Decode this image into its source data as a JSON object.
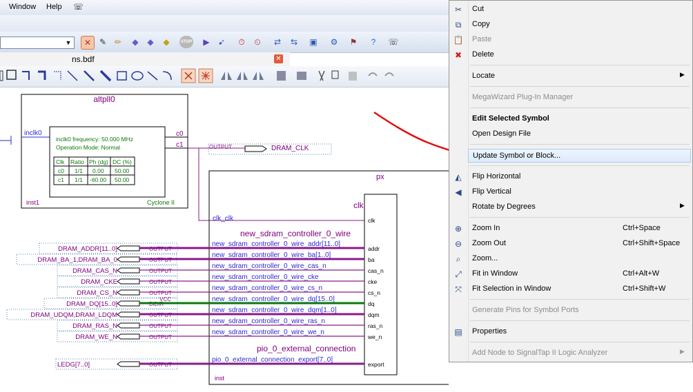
{
  "menubar": {
    "window_label": "Window",
    "help_label": "Help"
  },
  "doc_tab": {
    "title": "ns.bdf",
    "close_glyph": "✕"
  },
  "toolbar1": {
    "stop_label": "STOP"
  },
  "schematic": {
    "altpll": {
      "name": "altpll0",
      "pin_in": "inclk0",
      "pin_c0": "c0",
      "pin_c1": "c1",
      "info_freq": "inclk0 frequency: 50.000 MHz",
      "info_mode": "Operation Mode: Normal",
      "table_header": [
        "Clk",
        "Ratio",
        "Ph (dg)",
        "DC (%)"
      ],
      "table_rows": [
        [
          "c0",
          "1/1",
          "0.00",
          "50.00"
        ],
        [
          "c1",
          "1/1",
          "-60.00",
          "50.00"
        ]
      ],
      "inst": "inst1",
      "device": "Cyclone II"
    },
    "output_pin_label": "OUTPUT",
    "dram_clk": "DRAM_CLK",
    "px": {
      "name": "px",
      "clk_title": "clk",
      "clk_port": "clk",
      "clk_net": "clk_clk",
      "sdram_title": "new_sdram_controller_0_wire",
      "pio_title": "pio_0_external_connection",
      "inst": "inst",
      "corner": "px",
      "ports": [
        "addr",
        "ba",
        "cas_n",
        "cke",
        "cs_n",
        "dq",
        "dqm",
        "ras_n",
        "we_n"
      ],
      "export_port": "export",
      "wires": [
        "new_sdram_controller_0_wire_addr[11..0]",
        "new_sdram_controller_0_wire_ba[1..0]",
        "new_sdram_controller_0_wire_cas_n",
        "new_sdram_controller_0_wire_cke",
        "new_sdram_controller_0_wire_cs_n",
        "new_sdram_controller_0_wire_dq[15..0]",
        "new_sdram_controller_0_wire_dqm[1..0]",
        "new_sdram_controller_0_wire_ras_n",
        "new_sdram_controller_0_wire_we_n"
      ],
      "export_wire": "pio_0_external_connection_export[7..0]"
    },
    "pins": [
      "DRAM_ADDR[11..0]",
      "DRAM_BA_1,DRAM_BA_0",
      "DRAM_CAS_N",
      "DRAM_CKE",
      "DRAM_CS_N",
      "DRAM_DQ[15..0]",
      "DRAM_UDQM,DRAM_LDQM",
      "DRAM_RAS_N",
      "DRAM_WE_N"
    ],
    "pin_types": [
      "OUTPUT",
      "OUTPUT",
      "OUTPUT",
      "OUTPUT",
      "OUTPUT",
      "BIDIR",
      "OUTPUT",
      "OUTPUT",
      "OUTPUT"
    ],
    "vcc": "VCC",
    "ledg": "LEDG[7..0]"
  },
  "context_menu": {
    "items": [
      {
        "label": "Cut",
        "icon": "scissors-icon",
        "glyph": "✂",
        "shortcut": "",
        "disabled": false
      },
      {
        "label": "Copy",
        "icon": "copy-icon",
        "glyph": "⧉",
        "shortcut": "",
        "disabled": false
      },
      {
        "label": "Paste",
        "icon": "paste-icon",
        "glyph": "📋",
        "shortcut": "",
        "disabled": true
      },
      {
        "label": "Delete",
        "icon": "delete-icon",
        "glyph": "✖",
        "shortcut": "",
        "disabled": false
      },
      {
        "label": "Locate",
        "shortcut": "",
        "submenu": true
      },
      {
        "label": "MegaWizard Plug-In Manager",
        "shortcut": "",
        "disabled": true
      },
      {
        "label": "Edit Selected Symbol",
        "shortcut": "",
        "bold": true
      },
      {
        "label": "Open Design File",
        "shortcut": ""
      },
      {
        "label": "Update Symbol or Block...",
        "shortcut": "",
        "highlighted": true
      },
      {
        "label": "Flip Horizontal",
        "icon": "flip-horizontal-icon",
        "glyph": "◭",
        "shortcut": ""
      },
      {
        "label": "Flip Vertical",
        "icon": "flip-vertical-icon",
        "glyph": "◀",
        "shortcut": ""
      },
      {
        "label": "Rotate by Degrees",
        "shortcut": "",
        "submenu": true
      },
      {
        "label": "Zoom In",
        "icon": "zoom-in-icon",
        "glyph": "⊕",
        "shortcut": "Ctrl+Space"
      },
      {
        "label": "Zoom Out",
        "icon": "zoom-out-icon",
        "glyph": "⊖",
        "shortcut": "Ctrl+Shift+Space"
      },
      {
        "label": "Zoom...",
        "icon": "zoom-icon",
        "glyph": "⌕",
        "shortcut": ""
      },
      {
        "label": "Fit in Window",
        "icon": "fit-window-icon",
        "glyph": "⤢",
        "shortcut": "Ctrl+Alt+W"
      },
      {
        "label": "Fit Selection in Window",
        "icon": "fit-selection-icon",
        "glyph": "⤧",
        "shortcut": "Ctrl+Shift+W"
      },
      {
        "label": "Generate Pins for Symbol Ports",
        "shortcut": "",
        "disabled": true
      },
      {
        "label": "Properties",
        "icon": "properties-icon",
        "glyph": "▤",
        "shortcut": ""
      },
      {
        "label": "Add Node to SignalTap II Logic Analyzer",
        "shortcut": "",
        "disabled": true,
        "submenu": true
      }
    ]
  },
  "colors": {
    "accent_purple": "#800080",
    "pin_purple": "#8b1a8b",
    "net_green": "#0a7a0a",
    "wire_blue": "#2a2ad0",
    "annotation_red": "#e01010",
    "menu_highlight": "#dcebfb"
  }
}
